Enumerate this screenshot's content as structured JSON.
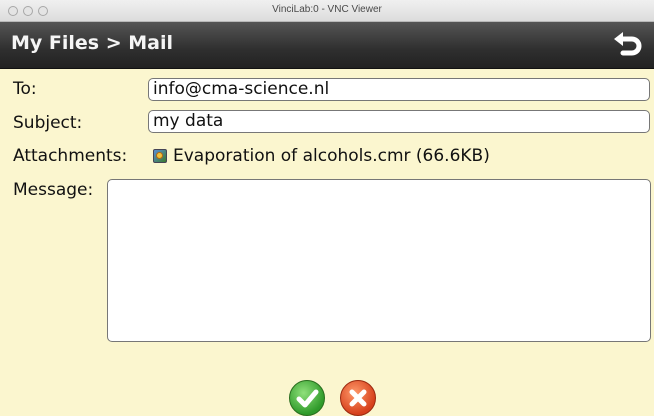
{
  "window": {
    "title": "VinciLab:0 - VNC Viewer"
  },
  "header": {
    "breadcrumb": "My Files > Mail",
    "back_icon": "back-arrow-icon"
  },
  "form": {
    "to_label": "To:",
    "to_value": "info@cma-science.nl",
    "subject_label": "Subject:",
    "subject_value": "my data",
    "attachments_label": "Attachments:",
    "attachment_name": "Evaporation of alcohols.cmr (66.6KB)",
    "message_label": "Message:",
    "message_value": ""
  },
  "actions": {
    "confirm_icon": "check-icon",
    "cancel_icon": "close-icon"
  },
  "colors": {
    "background": "#fbf6cf",
    "header": "#2f2f2f",
    "confirm": "#2f9a2a",
    "cancel": "#d6401c"
  }
}
